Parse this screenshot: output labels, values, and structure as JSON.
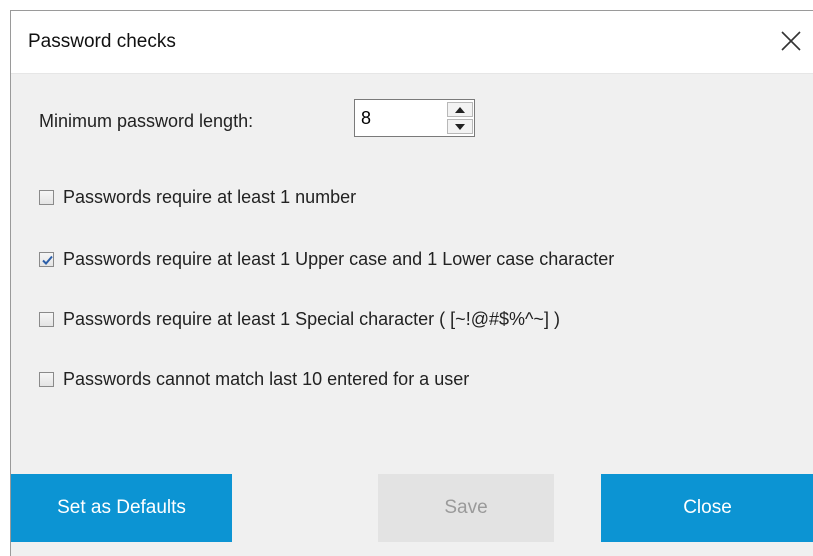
{
  "dialog": {
    "title": "Password checks",
    "min_length_label": "Minimum password length:",
    "min_length_value": "8"
  },
  "options": [
    {
      "label": "Passwords require at least 1 number",
      "checked": false
    },
    {
      "label": "Passwords require at least 1 Upper case and 1 Lower case character",
      "checked": true
    },
    {
      "label": "Passwords require at least 1 Special character (  [~!@#$%^~] )",
      "checked": false
    },
    {
      "label": "Passwords cannot match last 10 entered for a user",
      "checked": false
    }
  ],
  "buttons": {
    "defaults": "Set as Defaults",
    "save": "Save",
    "close": "Close"
  },
  "colors": {
    "accent": "#0c94d3",
    "disabled_bg": "#e3e3e3",
    "dialog_bg": "#f0f0f0"
  },
  "icons": {
    "close": "close-icon",
    "up": "chevron-up-icon",
    "down": "chevron-down-icon",
    "check": "checkmark-icon"
  }
}
